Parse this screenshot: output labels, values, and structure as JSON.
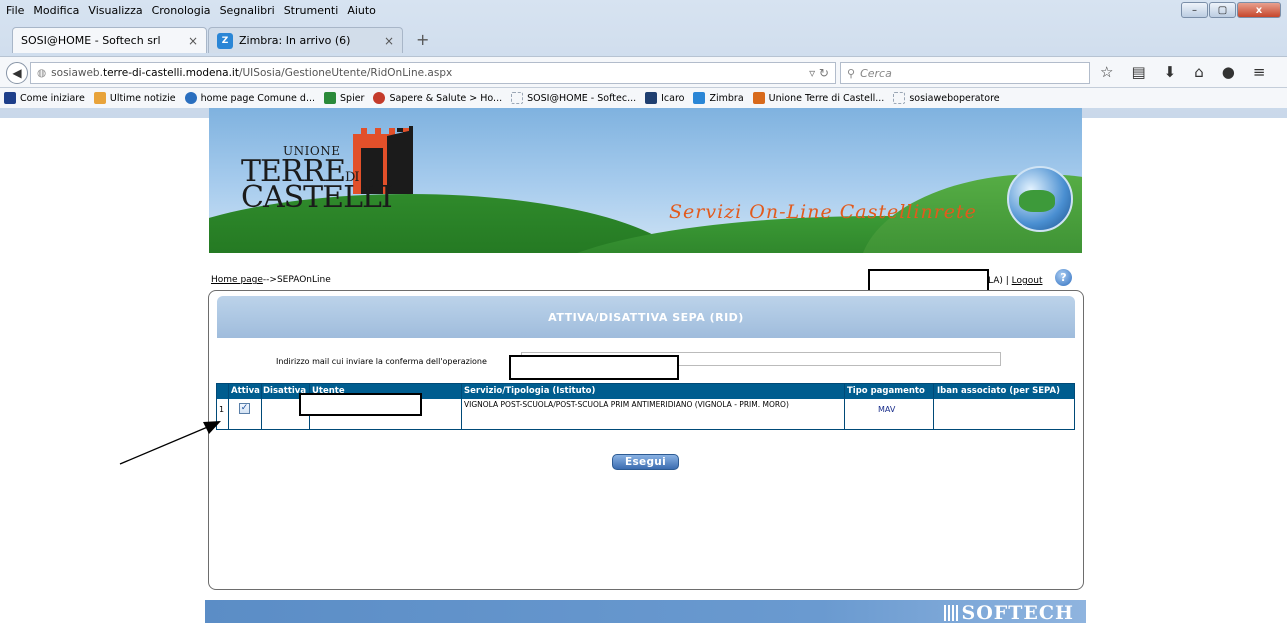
{
  "browser": {
    "menu": [
      "File",
      "Modifica",
      "Visualizza",
      "Cronologia",
      "Segnalibri",
      "Strumenti",
      "Aiuto"
    ],
    "window_controls": {
      "minimize": "–",
      "maximize": "▢",
      "close": "x"
    },
    "tabs": [
      {
        "title": "SOSI@HOME - Softech srl",
        "active": true
      },
      {
        "title": "Zimbra: In arrivo (6)",
        "active": false
      }
    ],
    "new_tab": "+",
    "address": {
      "prefix": "sosiaweb.",
      "domain": "terre-di-castelli.modena.it",
      "path": "/UISosia/GestioneUtente/RidOnLine.aspx"
    },
    "search_placeholder": "Cerca",
    "bookmarks": [
      {
        "label": "Come iniziare",
        "icon": "firefox-icon",
        "color": "#1e3f8a"
      },
      {
        "label": "Ultime notizie",
        "icon": "rss-icon",
        "color": "#e8a33a"
      },
      {
        "label": "home page Comune d...",
        "icon": "globe-icon",
        "color": "#2a6fbf"
      },
      {
        "label": "Spier",
        "icon": "spier-icon",
        "color": "#2b8a3a"
      },
      {
        "label": "Sapere & Salute > Ho...",
        "icon": "heart-icon",
        "color": "#c43b2b"
      },
      {
        "label": "SOSI@HOME - Softec...",
        "icon": "page-icon",
        "color": "#9aa6b5"
      },
      {
        "label": "Icaro",
        "icon": "icaro-icon",
        "color": "#1f3f70"
      },
      {
        "label": "Zimbra",
        "icon": "zimbra-icon",
        "color": "#2a86d6"
      },
      {
        "label": "Unione Terre di Castell...",
        "icon": "unione-icon",
        "color": "#d86a1c"
      },
      {
        "label": "sosiaweboperatore",
        "icon": "page-icon",
        "color": "#9aa6b5"
      }
    ]
  },
  "banner": {
    "logo_line1": "UNIONE",
    "logo_line2": "TERRE",
    "logo_line2_small": "DI",
    "logo_line3": "CASTELLI",
    "tagline": "Servizi On-Line Castellinrete"
  },
  "nav": {
    "home_link": "Home page",
    "crumb_rest": "-->SEPAOnLine",
    "user_suffix": "LA) |",
    "logout": "Logout",
    "help": "?"
  },
  "panel": {
    "title": "ATTIVA/DISATTIVA SEPA (RID)",
    "email_label": "Indirizzo mail cui inviare la conferma dell'operazione",
    "columns": [
      "Attiva",
      "Disattiva",
      "Utente",
      "Servizio/Tipologia (Istituto)",
      "Tipo pagamento",
      "Iban associato (per SEPA)"
    ],
    "rows": [
      {
        "num": "1",
        "attiva": true,
        "service": "VIGNOLA POST-SCUOLA/POST-SCUOLA PRIM ANTIMERIDIANO (VIGNOLA - PRIM. MORO)",
        "payment": "MAV",
        "iban": ""
      }
    ],
    "submit": "Esegui"
  },
  "footer": {
    "brand": "SOFTECH"
  }
}
